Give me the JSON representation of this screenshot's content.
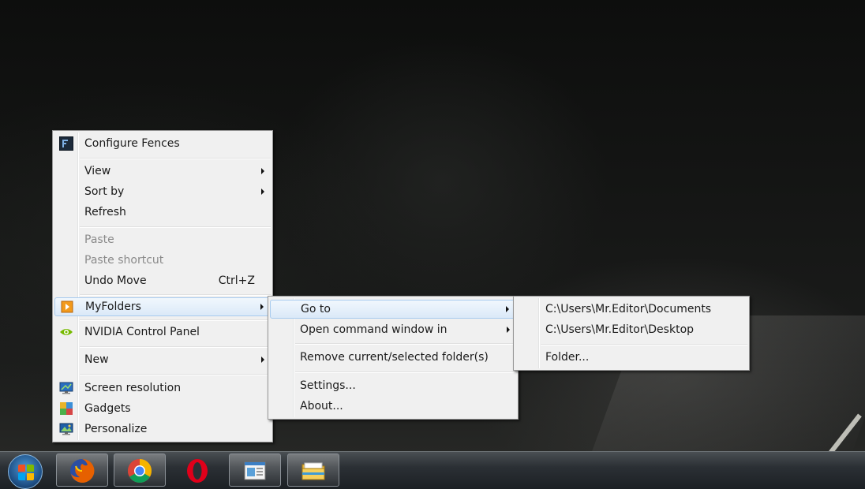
{
  "context_menu": {
    "items": [
      {
        "label": "Configure Fences",
        "icon": "fences-icon"
      },
      {
        "label": "View"
      },
      {
        "label": "Sort by"
      },
      {
        "label": "Refresh"
      },
      {
        "label": "Paste"
      },
      {
        "label": "Paste shortcut"
      },
      {
        "label": "Undo Move",
        "shortcut": "Ctrl+Z"
      },
      {
        "label": "MyFolders",
        "icon": "myfolders-icon"
      },
      {
        "label": "NVIDIA Control Panel",
        "icon": "nvidia-icon"
      },
      {
        "label": "New"
      },
      {
        "label": "Screen resolution",
        "icon": "screen-resolution-icon"
      },
      {
        "label": "Gadgets",
        "icon": "gadgets-icon"
      },
      {
        "label": "Personalize",
        "icon": "personalize-icon"
      }
    ]
  },
  "myfolders_menu": {
    "items": [
      {
        "label": "Go to"
      },
      {
        "label": "Open command window in"
      },
      {
        "label": "Remove current/selected folder(s)"
      },
      {
        "label": "Settings..."
      },
      {
        "label": "About..."
      }
    ]
  },
  "goto_menu": {
    "items": [
      {
        "label": "C:\\Users\\Mr.Editor\\Documents"
      },
      {
        "label": "C:\\Users\\Mr.Editor\\Desktop"
      },
      {
        "label": "Folder..."
      }
    ]
  },
  "taskbar": {
    "start": {
      "icon": "windows-logo-icon"
    },
    "apps": [
      {
        "icon": "firefox-icon"
      },
      {
        "icon": "chrome-icon"
      },
      {
        "icon": "opera-icon"
      },
      {
        "icon": "window-app-icon"
      },
      {
        "icon": "file-explorer-icon"
      }
    ]
  },
  "colors": {
    "menu_bg": "#f0f0f0",
    "highlight": "#dbe9f8",
    "highlight_border": "#a8cbee",
    "disabled_text": "#8a8a8a",
    "taskbar": "#2b3035"
  }
}
